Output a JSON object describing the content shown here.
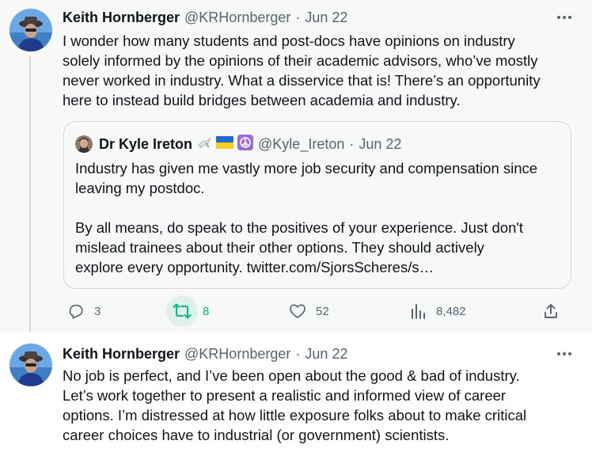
{
  "tweet1": {
    "author_name": "Keith Hornberger",
    "author_handle": "@KRHornberger",
    "separator": "·",
    "date": "Jun 22",
    "text_lines": [
      "I wonder how many students and post-docs have opinions on industry",
      "solely informed by the opinions of their academic advisors, who’ve mostly",
      "never worked in industry. What a disservice that is! There’s an opportunity",
      "here to instead build bridges between academia and industry."
    ],
    "quote": {
      "author_name": "Dr Kyle Ireton",
      "author_handle": "@Kyle_Ireton",
      "separator": "·",
      "date": "Jun 22",
      "emojis": [
        "dove",
        "ukraine-flag",
        "peace-symbol"
      ],
      "text_lines": [
        "Industry has given me vastly more job security and compensation since",
        "leaving my postdoc.",
        "",
        "By all means, do speak to the positives of your experience. Just don't",
        "mislead trainees about their other options. They should actively",
        "explore every opportunity. twitter.com/SjorsScheres/s…"
      ]
    },
    "actions": {
      "replies": "3",
      "retweets": "8",
      "likes": "52",
      "views": "8,482"
    }
  },
  "tweet2": {
    "author_name": "Keith Hornberger",
    "author_handle": "@KRHornberger",
    "separator": "·",
    "date": "Jun 22",
    "text_lines": [
      "No job is perfect, and I’ve been open about the good & bad of industry.",
      "Let’s work together to present a realistic and informed view of career",
      "options. I’m distressed at how little exposure folks about to make critical",
      "career choices have to industrial (or government) scientists."
    ]
  },
  "colors": {
    "text_primary": "#0f1419",
    "text_secondary": "#536471",
    "retweet_green": "#00ba7c",
    "border": "#cfd9de"
  }
}
